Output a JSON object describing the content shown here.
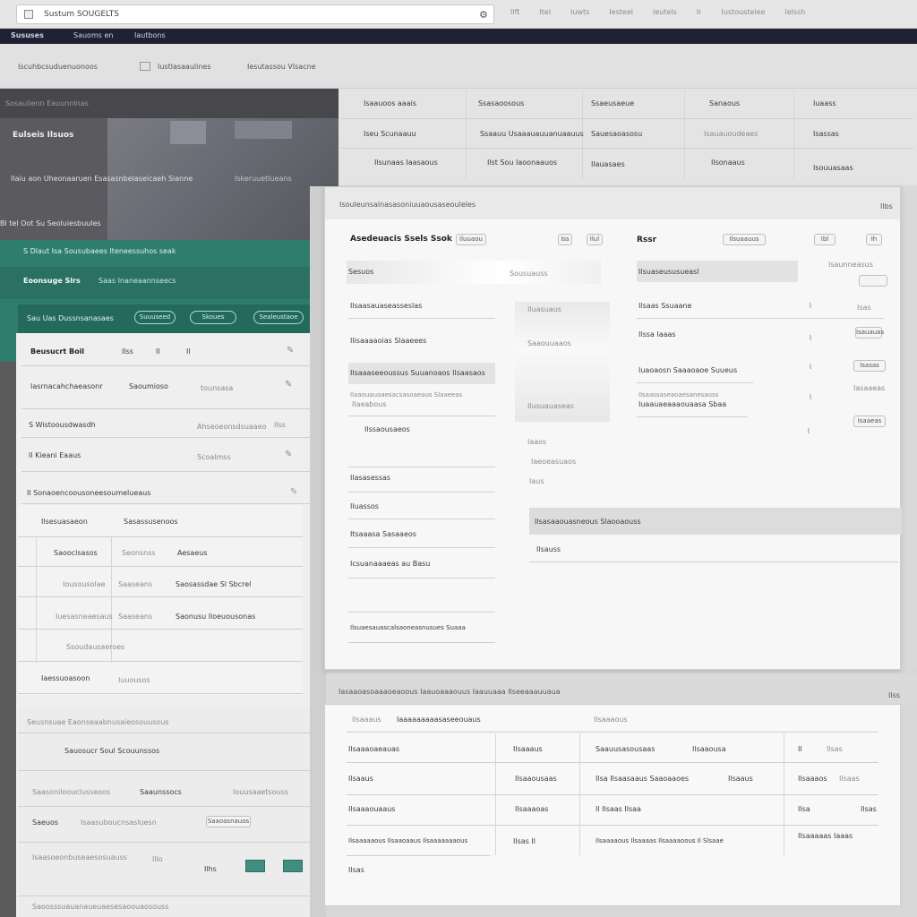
{
  "browser": {
    "address": "Sustum SOUGELTS",
    "nav_items": [
      "Ilft",
      "Itel",
      "Iuwts",
      "Iesteel",
      "Ieutels",
      "Ir",
      "Iustoustelee",
      "Ielssh"
    ]
  },
  "darkbar": {
    "tabs": [
      "Sususes",
      "Sauoms en",
      "Iautbons"
    ]
  },
  "subbar": {
    "items": [
      "Iscuhbcsuduenuonoos",
      "Iustlasaaulines",
      "Iesutassou Vlsacne"
    ]
  },
  "leftpanel": {
    "banner_strip": "Sosaulienn Eauunnlnas",
    "hero_title": "Eulseis Ilsuos",
    "hero_body": "Ilaiu aon Uheonaaruen Esasasnbelaseicaeh Sianne",
    "hero_link": "Iskeruuetlueans",
    "hero_footer": "Bl tel Oot Su Seoluiesbuules",
    "green_row1": "S Dlaut  Isa Sousubaees Iteneessuhos seak",
    "green_row2_title": "Eoonsuge Slrs",
    "green_row2_sub": "Saas Inaneaannseecs",
    "green_row3_title": "Sau Uas Dussnsanasaes",
    "green_buttons": [
      "Suuuseed",
      "Skoues",
      "Sealeustaoe"
    ],
    "rows": [
      {
        "title": "Beusucrt Boil",
        "c1": "Ilss",
        "c2": "Il",
        "c3": "Il"
      },
      {
        "title": "Iasrnacahchaeasonr",
        "c1": "Saoumioso",
        "c2": "tounsasa"
      },
      {
        "title": "S  Wistoousdwasdh",
        "c1": "Ahseoeonsdsuaaeo",
        "c2": "Ilss"
      },
      {
        "title": "Il  Kieani Eaaus",
        "c1": "Scoalmss"
      },
      {
        "title": "Il  Sonaoencoousoneesoumelueaus",
        "c1": ""
      }
    ],
    "subtable_head": [
      "Ilsesuasaeon",
      "Sasassusenoos"
    ],
    "subtable": [
      {
        "a": "Saooclsasos",
        "b": "Seonsnss",
        "c": "Aesaeus"
      },
      {
        "a": "Iousousolae",
        "b": "Saaseans",
        "c": "Saosassdae Sl Sbcrel"
      },
      {
        "a": "Iuesasneaesaus",
        "b": "Saaseans",
        "c": "Saonusu lloeuousonas"
      },
      {
        "a": "Ssoudausaeroes",
        "b": "",
        "c": ""
      },
      {
        "a": "Iaessuoasoon",
        "b": "Iuuousos",
        "c": ""
      }
    ],
    "bottom1": "Seusnsuae Eaonseaabnusaieosouusous",
    "bottom2": "Sauosucr Soul Scouunssos",
    "bottom3_a": "Saasoniloouclusseoos",
    "bottom3_b": "Saaunssocs",
    "bottom3_c": "Iouusaaetsouss",
    "bottom4_a": "Saeuos",
    "bottom4_b": "Isaasuboucnsasluesn",
    "bottom4_c": "Saaoasnauos",
    "bottom5": "Isaasoeonbuseaesosuauss",
    "bottom5_num": "Illo",
    "bottom5_label": "Ilhs",
    "bottom6": "Saoosssuauanaueuaesesaoouaosouss"
  },
  "toptable": {
    "rows": [
      [
        "Isaauoos aaais",
        "Ssasaoosous",
        "Ssaeusaeue",
        "Sanaous",
        "Iuaass"
      ],
      [
        "Iseu Scunaauu",
        "Ssaauu Usaaauauuanuaauus",
        "Sauesaoasosu",
        "Isauauoudeaes",
        "Isassas"
      ],
      [
        "Ilsunaas Iaasaous",
        "Ilst Sou Iaoonaauos",
        "Ilauasaes",
        "Ilsonaaus",
        "Isouuasaas"
      ]
    ]
  },
  "modal": {
    "header": "Isouleunsalnasasoniuuaousaseouleles",
    "header_num": "Ilbs",
    "left_title": "Asedeuacis Ssels Ssok",
    "left_badge": "Iluuaou",
    "left_badges": [
      "Iss",
      "Ilul"
    ],
    "right_title": "Rssr",
    "right_badge": "Ilsuaauus",
    "right_badges": [
      "Ibl",
      "Ih"
    ],
    "field_label": "Sesuos",
    "field_value": "Sousuauss",
    "field2_label": "Ilsuaseususueasl",
    "field2_value": "Isaunneasus",
    "left_rows": [
      "Ilsaasauaseasseslas",
      "Ilisaaaaoias Slaaeees",
      "Ilsaaaseeoussus Suuanoaos  Ilsaasaos",
      "Ilaaouauaaesacsasoaeaus Slaaeeas"
    ],
    "left_rows2": [
      "Ilaeabous",
      "Ilssaousaeos",
      "Ilasasessas",
      "Iluassos",
      "Itsaaasa Sasaaeos",
      "Icsuanaaaeas au Basu"
    ],
    "left_bottom": "Ilsuaesauascalsaoneasnusues Suaaa",
    "mid_items": [
      "Iluasuaus",
      "Saaouuaaos",
      "Ilusuauaseas",
      "Iaaos",
      "Iaeoeasuaos",
      "Iaus"
    ],
    "right_rows": [
      {
        "label": "Ilsaas Ssuaane",
        "val": "Isas"
      },
      {
        "label": "Ilssa Iaaas",
        "val": "Isauauas"
      },
      {
        "label": "Iuaoaosn Saaaoaoe Suueus",
        "val": "Isasas"
      },
      {
        "label": "Ilsaassaseaoaesanesauss",
        "val": "Iasaaeas"
      },
      {
        "label": "Iuaauaeaaaouaasa Sbaa",
        "val": "Isaaeas"
      }
    ],
    "section_bar": "Ilsasaaouasneous Slaooaouss",
    "section_value": "Ilsauss"
  },
  "lower": {
    "header": "Iasaaoasoaaaoeaoous Iaauoaaaouus  Iaauuaaa Ilseeaaauuaua",
    "header_num": "Ilss",
    "head_row": [
      "Ilsaaaus",
      "Iaaaaaaaaasaseeouaus",
      "Ilsaaaous"
    ],
    "rows": [
      [
        "Ilsaaaoaeauas",
        "Ilsaaaus",
        "Saauusasousaas",
        "Ilsaaousa",
        "Il",
        "Ilsas"
      ],
      [
        "Ilsaaus",
        "Ilsaaousaas",
        "Ilsa  Ilsaasaaus Saaoaaoes",
        "Ilsaaus",
        "Ilsaaaos",
        "Ilsaas"
      ],
      [
        "Ilsaaaouaaus",
        "Ilsaaaoas",
        "Il  Ilsaas Ilsaa",
        "Ilsa",
        "Ilsas",
        ""
      ],
      [
        "Ilsaaaaaous Ilsaaoaaus Ilsaaaaaaaous",
        "Ilsas Il",
        "Ilsaaaaous Ilsaaaas Ilsaaaaoous Il Slsaae",
        "Ilsaaaaas Iaaas",
        "",
        ""
      ],
      [
        "Ilsas",
        "",
        "",
        "",
        "",
        ""
      ]
    ]
  }
}
